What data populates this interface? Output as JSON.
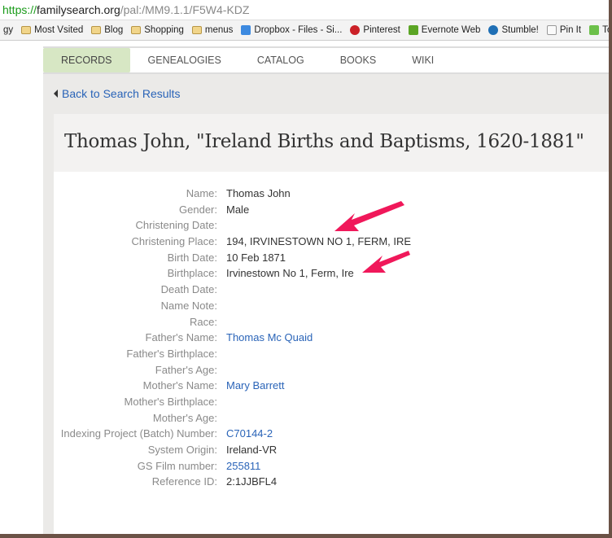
{
  "browser": {
    "url_scheme": "https://",
    "url_host": "familysearch.org",
    "url_path": "/pal:/MM9.1.1/F5W4-KDZ"
  },
  "bookmarks": [
    {
      "label": "gy",
      "icon": "folder-icon"
    },
    {
      "label": "Most Vsited",
      "icon": "folder-icon"
    },
    {
      "label": "Blog",
      "icon": "folder-icon"
    },
    {
      "label": "Shopping",
      "icon": "folder-icon"
    },
    {
      "label": "menus",
      "icon": "folder-icon"
    },
    {
      "label": "Dropbox - Files - Si...",
      "icon": "dropbox-icon"
    },
    {
      "label": "Pinterest",
      "icon": "pinterest-icon"
    },
    {
      "label": "Evernote Web",
      "icon": "evernote-icon"
    },
    {
      "label": "Stumble!",
      "icon": "stumbleupon-icon"
    },
    {
      "label": "Pin It",
      "icon": "page-icon"
    },
    {
      "label": "Today",
      "icon": "feedly-icon"
    }
  ],
  "nav": {
    "tabs": [
      "RECORDS",
      "GENEALOGIES",
      "CATALOG",
      "BOOKS",
      "WIKI"
    ],
    "active": "RECORDS"
  },
  "back_link": "Back to Search Results",
  "title": "Thomas John, \"Ireland Births and Baptisms, 1620-1881\"",
  "record": [
    {
      "label": "Name:",
      "value": "Thomas John"
    },
    {
      "label": "Gender:",
      "value": "Male"
    },
    {
      "label": "Christening Date:",
      "value": ""
    },
    {
      "label": "Christening Place:",
      "value": "194, IRVINESTOWN NO 1, FERM, IRE"
    },
    {
      "label": "Birth Date:",
      "value": "10 Feb 1871"
    },
    {
      "label": "Birthplace:",
      "value": "Irvinestown No 1, Ferm, Ire"
    },
    {
      "label": "Death Date:",
      "value": ""
    },
    {
      "label": "Name Note:",
      "value": ""
    },
    {
      "label": "Race:",
      "value": ""
    },
    {
      "label": "Father's Name:",
      "value": "Thomas Mc Quaid",
      "link": true
    },
    {
      "label": "Father's Birthplace:",
      "value": ""
    },
    {
      "label": "Father's Age:",
      "value": ""
    },
    {
      "label": "Mother's Name:",
      "value": "Mary Barrett",
      "link": true
    },
    {
      "label": "Mother's Birthplace:",
      "value": ""
    },
    {
      "label": "Mother's Age:",
      "value": ""
    },
    {
      "label": "Indexing Project (Batch) Number:",
      "value": "C70144-2",
      "link": true
    },
    {
      "label": "System Origin:",
      "value": "Ireland-VR"
    },
    {
      "label": "GS Film number:",
      "value": "255811",
      "link": true
    },
    {
      "label": "Reference ID:",
      "value": "2:1JJBFL4"
    }
  ],
  "colors": {
    "link": "#2a64b8",
    "active_tab": "#d7e7c4",
    "annotation_arrow": "#f0185a"
  }
}
